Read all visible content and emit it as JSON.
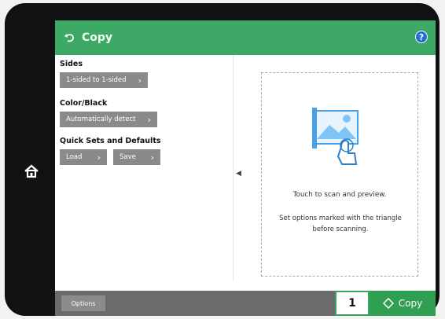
{
  "header": {
    "title": "Copy",
    "help_label": "?"
  },
  "settings": {
    "sides": {
      "label": "Sides",
      "value": "1-sided to 1-sided"
    },
    "color": {
      "label": "Color/Black",
      "value": "Automatically detect"
    },
    "quick": {
      "label": "Quick Sets and Defaults",
      "load": "Load",
      "save": "Save"
    }
  },
  "preview": {
    "title": "Touch to scan and preview.",
    "hint": "Set options marked with the triangle before scanning."
  },
  "footer": {
    "options": "Options",
    "copies": "1",
    "copy_label": "Copy"
  },
  "colors": {
    "accent": "#3ea866",
    "copy_btn": "#2f9f52",
    "button_gray": "#8a8a8a",
    "help_blue": "#1e6fd6"
  },
  "icons": {
    "back": "back-icon",
    "help": "help-icon",
    "home": "home-icon",
    "copy": "copy-diamond-icon",
    "preview": "scan-preview-icon"
  }
}
